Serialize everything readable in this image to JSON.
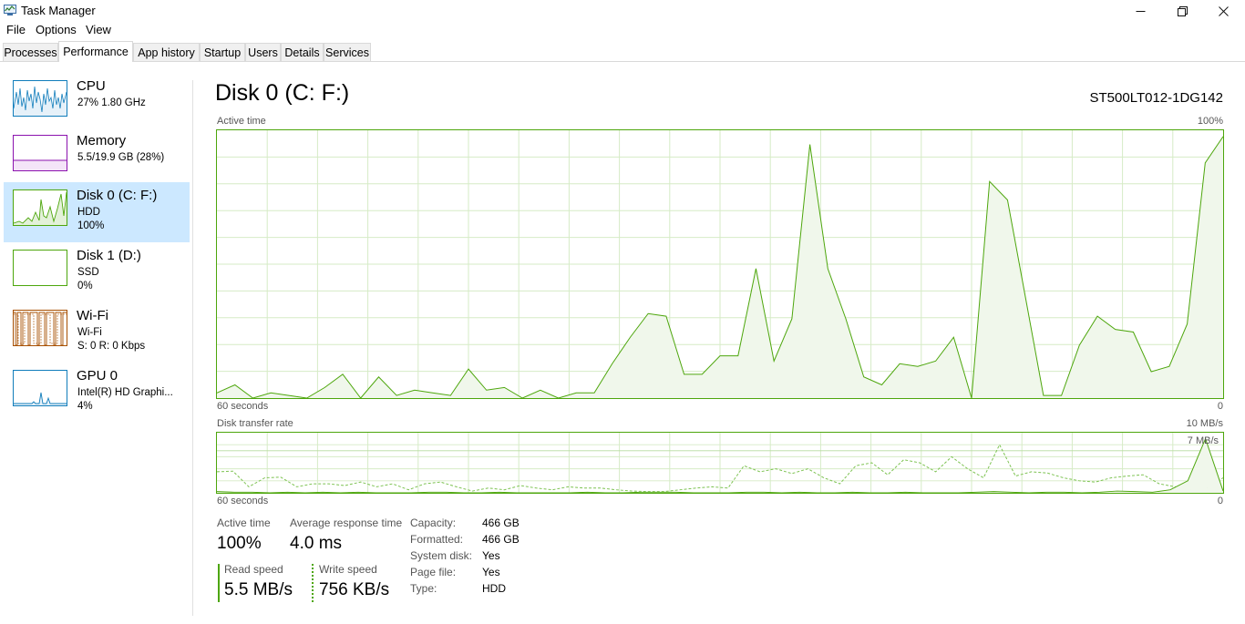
{
  "window": {
    "title": "Task Manager"
  },
  "menu": [
    "File",
    "Options",
    "View"
  ],
  "tabs": [
    "Processes",
    "Performance",
    "App history",
    "Startup",
    "Users",
    "Details",
    "Services"
  ],
  "active_tab": "Performance",
  "sidebar": [
    {
      "name": "CPU",
      "line1": "27% 1.80 GHz",
      "line2": "",
      "color": "#117dbb"
    },
    {
      "name": "Memory",
      "line1": "5.5/19.9 GB (28%)",
      "line2": "",
      "color": "#8b12ae"
    },
    {
      "name": "Disk 0 (C: F:)",
      "line1": "HDD",
      "line2": "100%",
      "color": "#4da60c",
      "selected": true
    },
    {
      "name": "Disk 1 (D:)",
      "line1": "SSD",
      "line2": "0%",
      "color": "#4da60c"
    },
    {
      "name": "Wi-Fi",
      "line1": "Wi-Fi",
      "line2": "S: 0 R: 0 Kbps",
      "color": "#a74f01"
    },
    {
      "name": "GPU 0",
      "line1": "Intel(R) HD Graphi...",
      "line2": "4%",
      "color": "#117dbb"
    }
  ],
  "main": {
    "title": "Disk 0 (C: F:)",
    "model": "ST500LT012-1DG142",
    "active_time_label": "Active time",
    "active_time_max": "100%",
    "left_axis_label": "60 seconds",
    "right_axis_label": "0",
    "transfer_label": "Disk transfer rate",
    "transfer_max": "10 MB/s",
    "transfer_marker": "7 MB/s"
  },
  "chart_data": [
    {
      "type": "area",
      "title": "Active time",
      "xlabel": "60 seconds",
      "ylim": [
        0,
        100
      ],
      "xlim": [
        60,
        0
      ],
      "series": [
        {
          "values": [
            2,
            5,
            0,
            2,
            1,
            0,
            4,
            9,
            0,
            8,
            1,
            3,
            2,
            1,
            11,
            3,
            4,
            0,
            3,
            0,
            2,
            2,
            13,
            23,
            32,
            31,
            9,
            9,
            16,
            16,
            49,
            14,
            30,
            96,
            49,
            30,
            8,
            5,
            13,
            12,
            14,
            23,
            0,
            82,
            75,
            38,
            1,
            1,
            20,
            31,
            26,
            25,
            10,
            12,
            28,
            89,
            99
          ]
        }
      ]
    },
    {
      "type": "line",
      "title": "Disk transfer rate",
      "ylim": [
        0,
        10
      ],
      "unit": "MB/s",
      "series": [
        {
          "values": [
            0.2,
            0.1,
            0.1,
            0.0,
            0.1,
            0.0,
            0.1,
            0.0,
            0.1,
            0.0,
            0.0,
            0.0,
            0.1,
            0.1,
            0.0,
            0.0,
            0.1,
            0.0,
            0.0,
            0.0,
            0.0,
            0.1,
            0.0,
            0.0,
            0.1,
            0.1,
            0.1,
            0.0,
            0.0,
            0.0,
            0.1,
            0.1,
            0.0,
            0.1,
            0.0,
            0.0,
            0.1,
            0.0,
            0.0,
            0.1,
            0.0,
            0.0,
            0.0,
            0.1,
            0.2,
            0.1,
            0.0,
            0.1,
            0.1,
            0.0,
            0.1,
            0.3,
            0.2,
            0.1,
            0.5,
            2.0,
            9.0,
            0.3
          ]
        },
        {
          "values": [
            3.5,
            3.6,
            1.0,
            2.5,
            2.6,
            1.0,
            1.5,
            1.5,
            1.2,
            1.8,
            1.0,
            1.5,
            0.5,
            1.5,
            1.8,
            1.0,
            0.3,
            0.8,
            0.5,
            1.2,
            0.8,
            0.5,
            1.0,
            0.8,
            0.8,
            0.5,
            0.3,
            0.2,
            0.2,
            0.5,
            0.8,
            1.0,
            0.8,
            4.5,
            3.5,
            4.0,
            3.2,
            4.0,
            2.5,
            1.5,
            4.5,
            5.0,
            3.0,
            5.5,
            5.0,
            3.5,
            6.0,
            4.0,
            2.5,
            8.0,
            2.8,
            3.5,
            3.3,
            2.5,
            2.0,
            1.8,
            2.5,
            2.8,
            3.0,
            1.5,
            1.0,
            0.5,
            0.8,
            2.5
          ]
        }
      ]
    }
  ],
  "stats": {
    "active_time": {
      "label": "Active time",
      "value": "100%"
    },
    "avg_response": {
      "label": "Average response time",
      "value": "4.0 ms"
    },
    "read_speed": {
      "label": "Read speed",
      "value": "5.5 MB/s"
    },
    "write_speed": {
      "label": "Write speed",
      "value": "756 KB/s"
    }
  },
  "properties": [
    {
      "label": "Capacity:",
      "value": "466 GB"
    },
    {
      "label": "Formatted:",
      "value": "466 GB"
    },
    {
      "label": "System disk:",
      "value": "Yes"
    },
    {
      "label": "Page file:",
      "value": "Yes"
    },
    {
      "label": "Type:",
      "value": "HDD"
    }
  ],
  "colors": {
    "disk": "#4da60c",
    "disk_fill": "#f0f7eb",
    "grid": "#d6ebc6",
    "selected": "#cce8ff"
  },
  "icons": [
    "task-manager-icon",
    "minimize-icon",
    "maximize-icon",
    "close-icon"
  ]
}
